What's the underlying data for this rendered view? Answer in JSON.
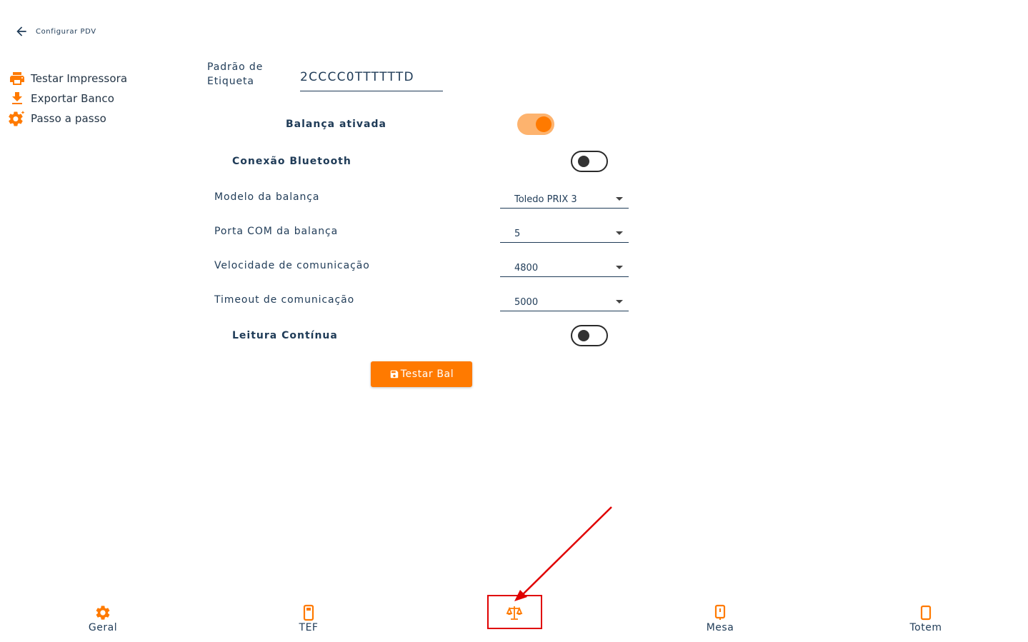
{
  "header": {
    "title": "Configurar PDV",
    "back_icon": "arrow-left-icon"
  },
  "side_menu": {
    "items": [
      {
        "label": "Testar Impressora",
        "icon": "printer-icon"
      },
      {
        "label": "Exportar Banco",
        "icon": "download-icon"
      },
      {
        "label": "Passo a passo",
        "icon": "gear-sparkle-icon"
      }
    ]
  },
  "form": {
    "etiqueta_label_line1": "Padrão de",
    "etiqueta_label_line2": "Etiqueta",
    "etiqueta_value": "2CCCC0TTTTTTD",
    "balanca_ativada_label": "Balança ativada",
    "balanca_ativada": true,
    "bluetooth_label": "Conexão Bluetooth",
    "bluetooth": false,
    "modelo_label": "Modelo da balança",
    "modelo_value": "Toledo PRIX 3",
    "porta_label": "Porta COM da balança",
    "porta_value": "5",
    "velocidade_label": "Velocidade de comunicação",
    "velocidade_value": "4800",
    "timeout_label": "Timeout de comunicação",
    "timeout_value": "5000",
    "leitura_label": "Leitura Contínua",
    "leitura": false,
    "test_button_label": "Testar Bal"
  },
  "bottom_nav": {
    "items": [
      {
        "label": "Geral",
        "icon": "gear-icon"
      },
      {
        "label": "TEF",
        "icon": "pos-terminal-icon"
      },
      {
        "label": "",
        "icon": "scale-icon",
        "active": true
      },
      {
        "label": "Mesa",
        "icon": "table-device-icon"
      },
      {
        "label": "Totem",
        "icon": "tablet-icon"
      }
    ]
  },
  "colors": {
    "accent": "#ff7a00",
    "accent_light": "#fdb36e",
    "text": "#1f3b57",
    "annotation": "#e00000"
  }
}
